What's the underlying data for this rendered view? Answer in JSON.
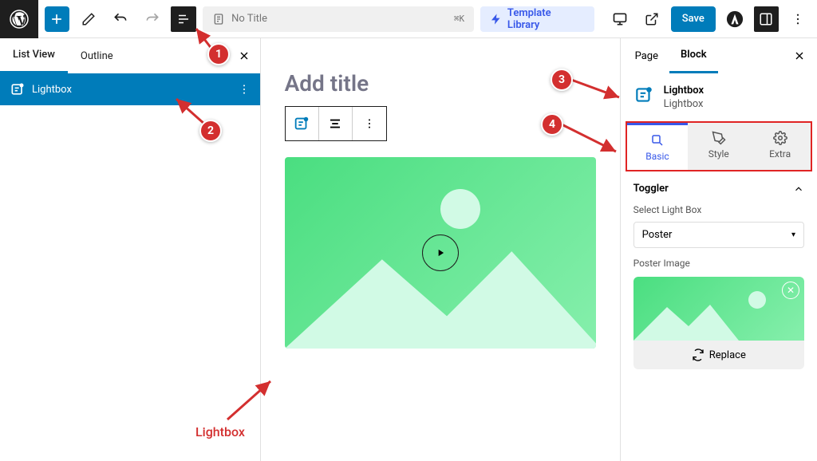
{
  "toolbar": {
    "title_placeholder": "No Title",
    "keyboard_shortcut": "⌘K",
    "template_library": "Template Library",
    "save": "Save"
  },
  "left_panel": {
    "tabs": {
      "list_view": "List View",
      "outline": "Outline"
    },
    "item": {
      "label": "Lightbox"
    }
  },
  "canvas": {
    "add_title": "Add title",
    "annotation_label": "Lightbox"
  },
  "right_panel": {
    "tabs": {
      "page": "Page",
      "block": "Block"
    },
    "block_name": "Lightbox",
    "block_desc": "Lightbox",
    "modes": {
      "basic": "Basic",
      "style": "Style",
      "extra": "Extra"
    },
    "section_toggler": "Toggler",
    "select_lightbox_label": "Select Light Box",
    "select_lightbox_value": "Poster",
    "poster_image_label": "Poster Image",
    "replace": "Replace"
  },
  "callouts": {
    "c1": "1",
    "c2": "2",
    "c3": "3",
    "c4": "4"
  }
}
